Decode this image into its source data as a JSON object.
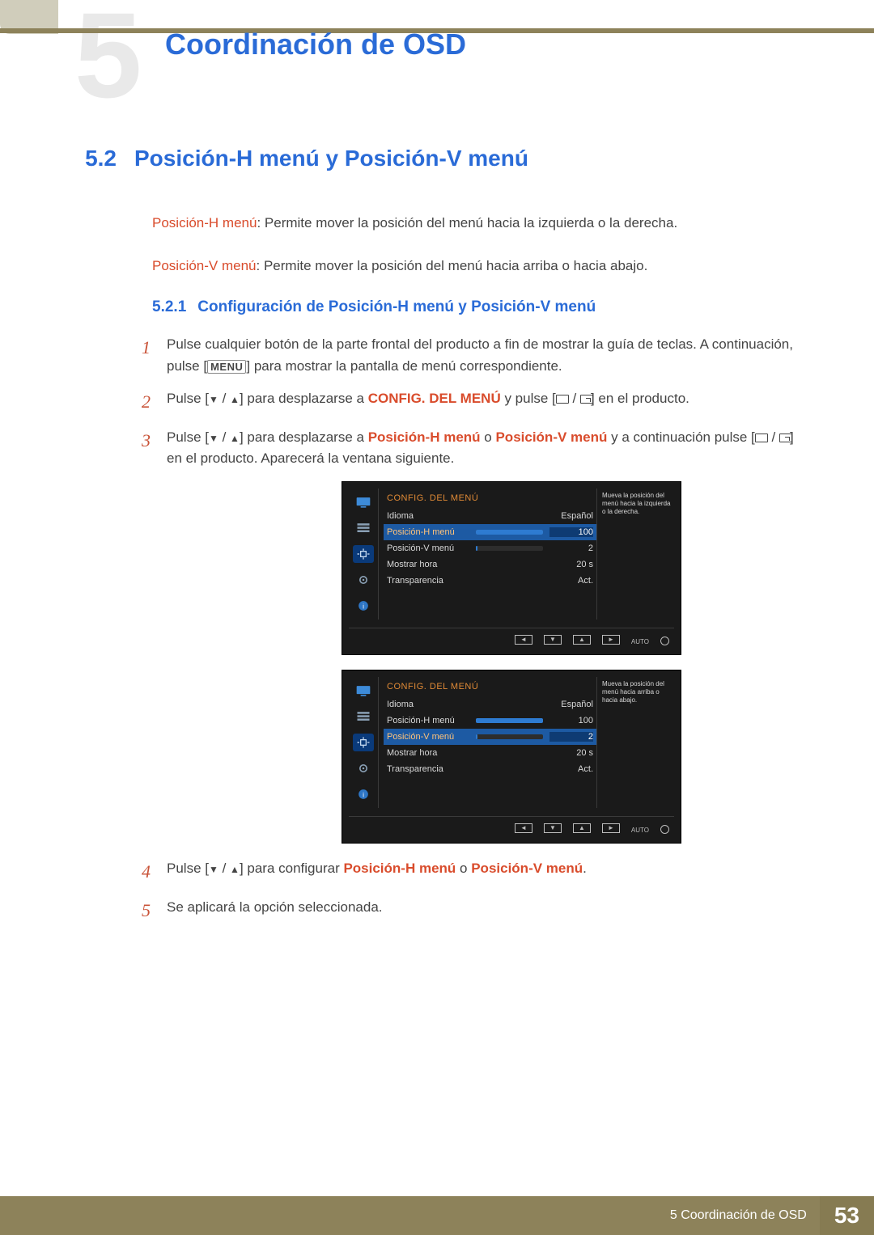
{
  "chapter_ghost": "5",
  "chapter_title": "Coordinación de OSD",
  "section": {
    "num": "5.2",
    "title": "Posición-H menú y Posición-V menú"
  },
  "defs": {
    "h": {
      "term": "Posición-H menú",
      "text": ": Permite mover la posición del menú hacia la izquierda o la derecha."
    },
    "v": {
      "term": "Posición-V menú",
      "text": ": Permite mover la posición del menú hacia arriba o hacia abajo."
    }
  },
  "subsection": {
    "num": "5.2.1",
    "title": "Configuración de Posición-H menú y Posición-V menú"
  },
  "steps": {
    "s1a": "Pulse cualquier botón de la parte frontal del producto a fin de mostrar la guía de teclas. A continuación, pulse [",
    "s1_menu": "MENU",
    "s1b": "] para mostrar la pantalla de menú correspondiente.",
    "s2a": "Pulse [",
    "s2b": "] para desplazarse a ",
    "s2_hl": "CONFIG. DEL MENÚ",
    "s2c": " y pulse [",
    "s2d": "] en el producto.",
    "s3a": "Pulse [",
    "s3b": "] para desplazarse a ",
    "s3_h": "Posición-H menú",
    "s3_o": " o ",
    "s3_v": "Posición-V menú",
    "s3c": " y a continuación pulse [",
    "s3d": "] en el producto. Aparecerá la ventana siguiente.",
    "s4a": "Pulse [",
    "s4b": "] para configurar ",
    "s4_h": "Posición-H menú",
    "s4_o": " o ",
    "s4_v": "Posición-V menú",
    "s4c": ".",
    "s5": "Se aplicará la opción seleccionada."
  },
  "osd": {
    "title": "CONFIG. DEL MENÚ",
    "rows": {
      "idioma": {
        "label": "Idioma",
        "value": "Español"
      },
      "posH": {
        "label": "Posición-H menú",
        "value": "100",
        "pct": 100
      },
      "posV": {
        "label": "Posición-V menú",
        "value": "2",
        "pct": 2
      },
      "mostrar": {
        "label": "Mostrar hora",
        "value": "20 s"
      },
      "transp": {
        "label": "Transparencia",
        "value": "Act."
      }
    },
    "hint1": "Mueva la posición del menú hacia la izquierda o la derecha.",
    "hint2": "Mueva la posición del menú hacia arriba o hacia abajo.",
    "footer": {
      "auto": "AUTO"
    }
  },
  "footer": {
    "label": "5 Coordinación de OSD",
    "page": "53"
  }
}
